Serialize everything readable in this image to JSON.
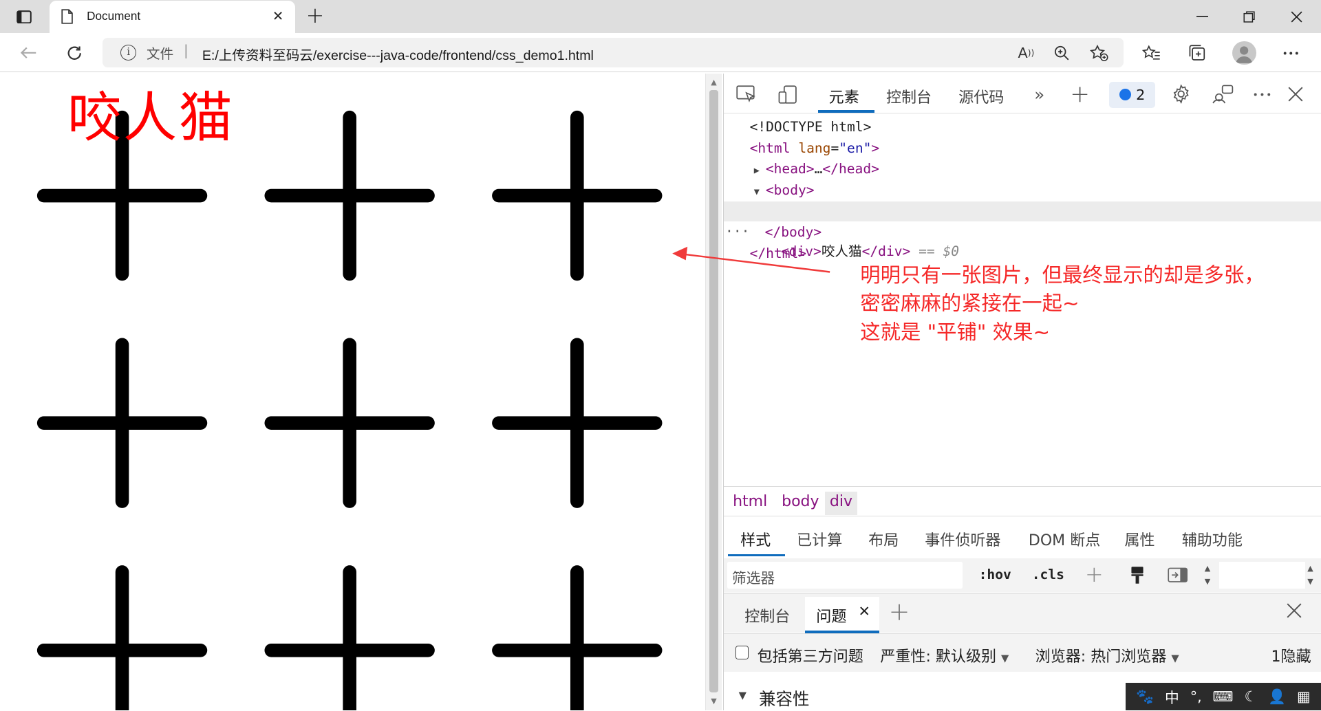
{
  "browser": {
    "tab": {
      "title": "Document"
    },
    "address": {
      "scheme_label": "文件",
      "separator": "|",
      "url": "E:/上传资料至码云/exercise---java-code/frontend/css_demo1.html"
    }
  },
  "page": {
    "div_text": "咬人猫",
    "background_tile": {
      "image": "plus-sign",
      "repeat": "repeat",
      "color": "#000000"
    }
  },
  "devtools": {
    "tabs": [
      "元素",
      "控制台",
      "源代码"
    ],
    "active_tab": "元素",
    "issues_count": "2",
    "dom": {
      "doctype": "<!DOCTYPE html>",
      "html_open": "html",
      "lang_attr": "lang",
      "lang_val": "\"en\"",
      "head": "head",
      "head_ellipsis": "…",
      "body": "body",
      "div_tag": "div",
      "div_text": "咬人猫",
      "dollar": "== $0",
      "selected_dots": "···"
    },
    "breadcrumbs": [
      "html",
      "body",
      "div"
    ],
    "styles_tabs": [
      "样式",
      "已计算",
      "布局",
      "事件侦听器",
      "DOM 断点",
      "属性",
      "辅助功能"
    ],
    "filter_placeholder": "筛选器",
    "hov": ":hov",
    "cls": ".cls",
    "drawer_tabs": [
      "控制台",
      "问题"
    ],
    "issues_toolbar": {
      "third_party": "包括第三方问题",
      "severity": "严重性: 默认级别",
      "browser": "浏览器:  热门浏览器",
      "hidden": "1隐藏"
    },
    "compat": "兼容性"
  },
  "annotation": {
    "lines": [
      "明明只有一张图片，但最终显示的却是多张，",
      "密密麻麻的紧接在一起~",
      "这就是 \"平铺\" 效果~"
    ],
    "color": "#f52828"
  },
  "ime": {
    "lang": "中"
  },
  "colors": {
    "accent": "#0f6cbd",
    "tag": "#881280",
    "annotation": "#f52828",
    "page_text": "#ff0000"
  }
}
